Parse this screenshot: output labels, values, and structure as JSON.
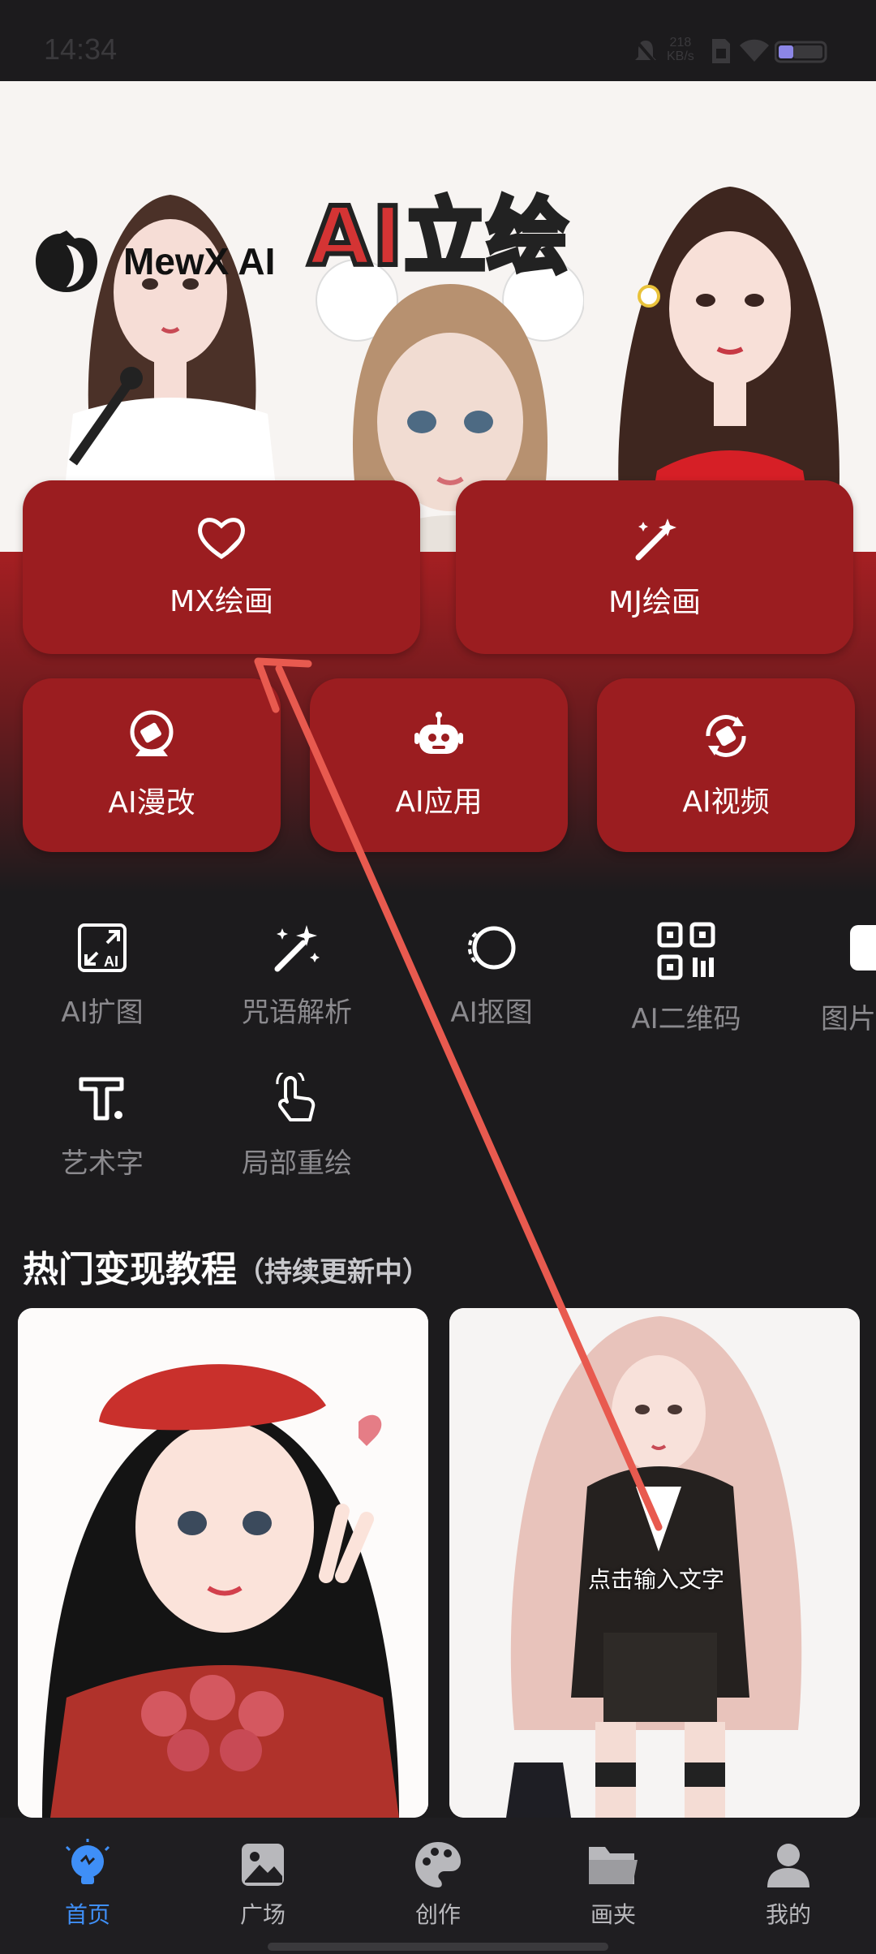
{
  "status_bar": {
    "time": "14:34",
    "network_speed_value": "218",
    "network_speed_unit": "KB/s"
  },
  "banner": {
    "brand": "MewX AI",
    "title": "AI立绘"
  },
  "feature_cards": [
    {
      "label": "MX绘画",
      "icon": "heart-brush-icon"
    },
    {
      "label": "MJ绘画",
      "icon": "magic-wand-icon"
    },
    {
      "label": "AI漫改",
      "icon": "crystal-ball-icon"
    },
    {
      "label": "AI应用",
      "icon": "robot-icon"
    },
    {
      "label": "AI视频",
      "icon": "video-refresh-icon"
    }
  ],
  "tools": [
    {
      "label": "AI扩图",
      "icon": "expand-image-icon"
    },
    {
      "label": "咒语解析",
      "icon": "sparkle-wand-icon"
    },
    {
      "label": "AI抠图",
      "icon": "cutout-icon"
    },
    {
      "label": "AI二维码",
      "icon": "qr-code-icon"
    },
    {
      "label": "图片",
      "icon": "image-icon"
    },
    {
      "label": "艺术字",
      "icon": "art-text-icon"
    },
    {
      "label": "局部重绘",
      "icon": "touch-redraw-icon"
    }
  ],
  "section": {
    "title": "热门变现教程",
    "subtitle": "（持续更新中）"
  },
  "posts": [
    {
      "overlay": ""
    },
    {
      "overlay": "点击输入文字"
    }
  ],
  "bottom_nav": [
    {
      "label": "首页",
      "icon": "lightbulb-icon",
      "active": true
    },
    {
      "label": "广场",
      "icon": "gallery-icon",
      "active": false
    },
    {
      "label": "创作",
      "icon": "palette-icon",
      "active": false
    },
    {
      "label": "画夹",
      "icon": "folder-icon",
      "active": false
    },
    {
      "label": "我的",
      "icon": "user-icon",
      "active": false
    }
  ],
  "colors": {
    "accent_red": "#9b1d20",
    "active_blue": "#3f8ff7",
    "background": "#1c1b1d",
    "annotation_arrow": "#e85a4f"
  }
}
